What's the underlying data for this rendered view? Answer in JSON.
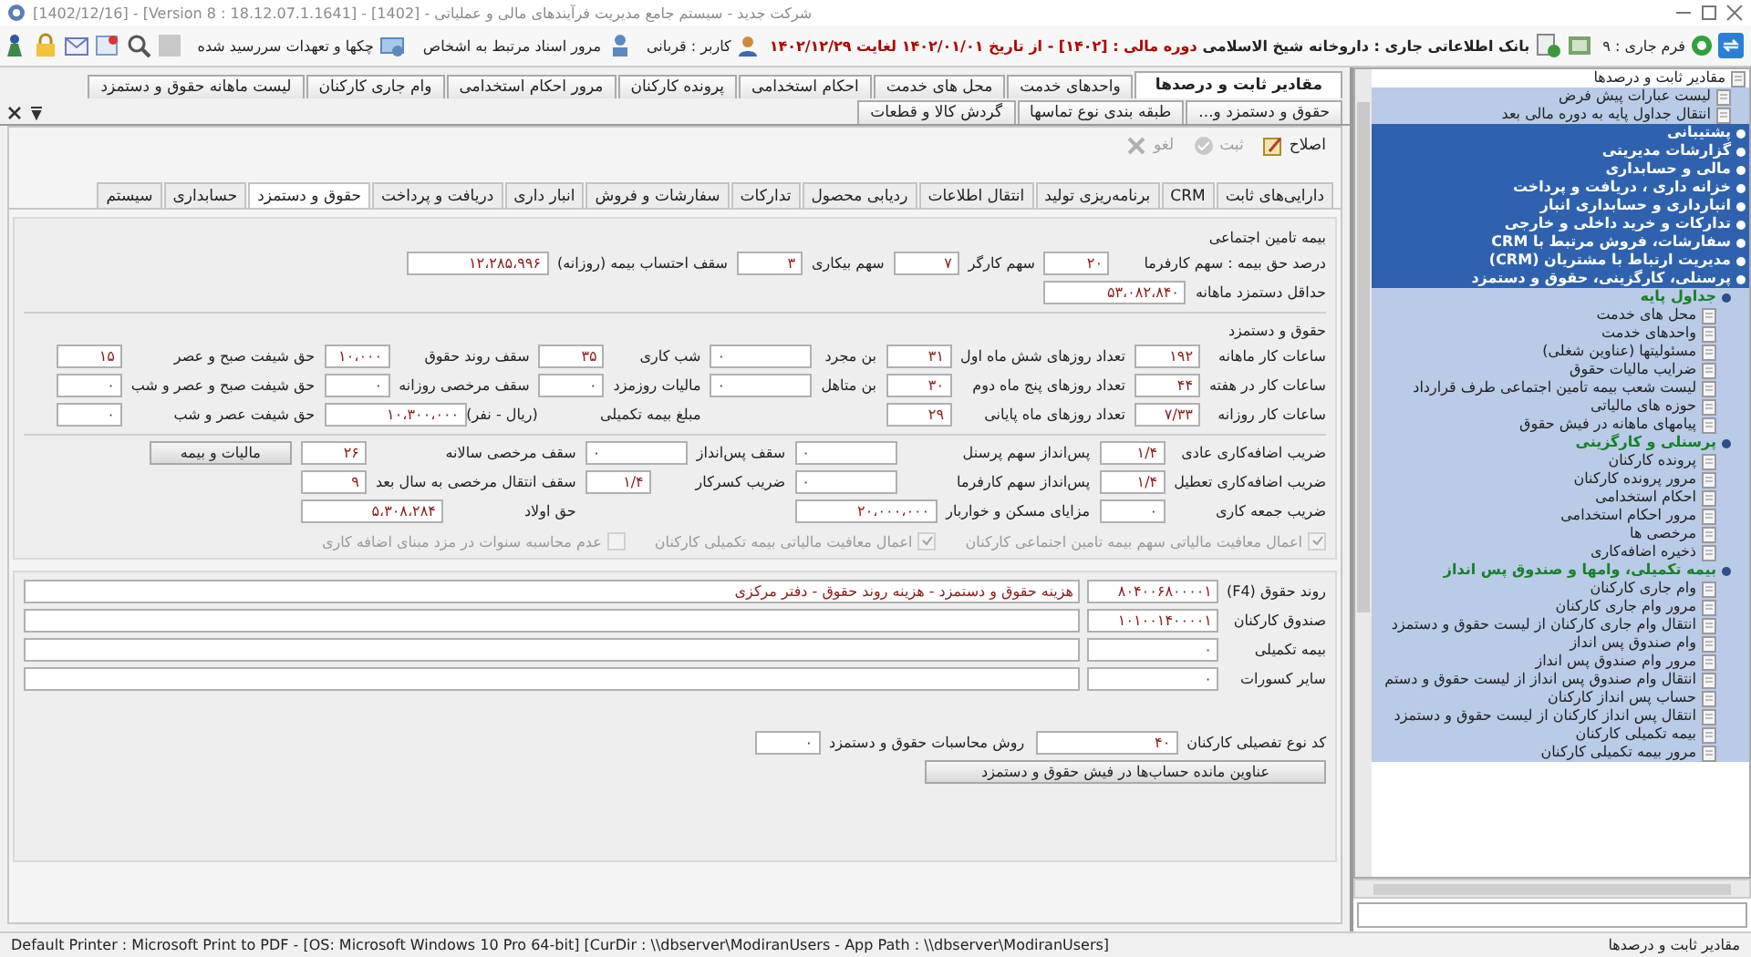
{
  "window": {
    "title": "شرکت جدید - سیستم جامع مدیریت فرآیندهای مالی و عملیاتی - [1402] - [Version 8 : 18.12.07.1.1641] - [1402/12/16]"
  },
  "toolbar": {
    "current_form": "فرم جاری : ۹",
    "database": "بانک اطلاعاتی جاری : داروخانه شیخ الاسلامی",
    "fiscal_period": "دوره مالی : [۱۴۰۲] - از تاریخ ۱۴۰۲/۰۱/۰۱ لغایت ۱۴۰۲/۱۲/۲۹",
    "user": "کاربر : قربانی",
    "links": [
      {
        "label": "مرور اسناد مرتبط به اشخاص"
      },
      {
        "label": "چکها و تعهدات سررسید شده"
      }
    ]
  },
  "document_tabs": [
    {
      "label": "مقادیر ثابت و درصدها",
      "selected": true
    },
    {
      "label": "واحدهای خدمت",
      "selected": false
    },
    {
      "label": "محل های خدمت",
      "selected": false
    },
    {
      "label": "احکام استخدامی",
      "selected": false
    },
    {
      "label": "پرونده کارکنان",
      "selected": false
    },
    {
      "label": "مرور احکام استخدامی",
      "selected": false
    },
    {
      "label": "وام جاری کارکنان",
      "selected": false
    },
    {
      "label": "لیست ماهانه حقوق و دستمزد",
      "selected": false
    },
    {
      "label": "حقوق و دستمزد و...",
      "selected": false
    },
    {
      "label": "طبقه بندی نوع تماسها",
      "selected": false
    },
    {
      "label": "گردش کالا و قطعات",
      "selected": false
    }
  ],
  "panel_toolbar": [
    {
      "label": "اصلاح",
      "disabled": false
    },
    {
      "label": "ثبت",
      "disabled": true
    },
    {
      "label": "لغو",
      "disabled": true
    }
  ],
  "module_tabs": [
    {
      "label": "دارایی‌های ثابت",
      "selected": false
    },
    {
      "label": "CRM",
      "selected": false
    },
    {
      "label": "برنامه‌ریزی تولید",
      "selected": false
    },
    {
      "label": "انتقال اطلاعات",
      "selected": false
    },
    {
      "label": "ردیابی محصول",
      "selected": false
    },
    {
      "label": "تدارکات",
      "selected": false
    },
    {
      "label": "سفارشات و فروش",
      "selected": false
    },
    {
      "label": "انبار داری",
      "selected": false
    },
    {
      "label": "دریافت و پرداخت",
      "selected": false
    },
    {
      "label": "حقوق و دستمزد",
      "selected": true
    },
    {
      "label": "حسابداری",
      "selected": false
    },
    {
      "label": "سیستم",
      "selected": false
    }
  ],
  "form": {
    "sections": [
      {
        "title": "بیمه تامین اجتماعی",
        "rows": [
          [
            {
              "kind": "number",
              "label": "درصد حق بیمه :  سهم کارفرما",
              "value": "۲۰"
            },
            {
              "kind": "number",
              "label": "سهم کارگر",
              "value": "۷"
            },
            {
              "kind": "number",
              "label": "سهم بیکاری",
              "value": "۳"
            },
            {
              "kind": "amount",
              "label": "سقف احتساب بیمه (روزانه)",
              "value": "۱۲،۲۸۵،۹۹۶"
            }
          ],
          [
            {
              "kind": "amount",
              "label": "حداقل دستمزد ماهانه",
              "value": "۵۳،۰۸۲،۸۴۰"
            }
          ]
        ]
      },
      {
        "title": "حقوق و دستمزد",
        "rows": [
          [
            {
              "kind": "number",
              "label": "ساعات کار ماهانه",
              "value": "۱۹۲"
            },
            {
              "kind": "number",
              "label": "تعداد روزهای شش ماه اول",
              "value": "۳۱"
            },
            {
              "kind": "select",
              "label": "بن مجرد",
              "value": "۰"
            },
            {
              "kind": "number",
              "label": "شب کاری",
              "value": "۳۵"
            },
            {
              "kind": "number",
              "label": "سقف روند حقوق",
              "value": "۱۰،۰۰۰"
            },
            {
              "kind": "number",
              "label": "حق شیفت صبح و عصر",
              "value": "۱۵"
            }
          ],
          [
            {
              "kind": "number",
              "label": "ساعات کار در هفته",
              "value": "۴۴"
            },
            {
              "kind": "number",
              "label": "تعداد روزهای پنج ماه دوم",
              "value": "۳۰"
            },
            {
              "kind": "select",
              "label": "بن متاهل",
              "value": "۰"
            },
            {
              "kind": "number",
              "label": "مالیات روزمزد",
              "value": "۰"
            },
            {
              "kind": "number",
              "label": "سقف مرخصی روزانه",
              "value": "۰"
            },
            {
              "kind": "number",
              "label": "حق شیفت صبح و عصر و شب",
              "value": "۰"
            }
          ],
          [
            {
              "kind": "number",
              "label": "ساعات کار روزانه",
              "value": "۷/۳۳"
            },
            {
              "kind": "number",
              "label": "تعداد روزهای ماه پایانی",
              "value": "۲۹"
            },
            null,
            {
              "kind": "amount",
              "label": "مبلغ بیمه تکمیلی",
              "value": "۱۰،۳۰۰،۰۰۰",
              "unit": "(ریال - نفر)"
            },
            null,
            {
              "kind": "number",
              "label": "حق شیفت عصر و شب",
              "value": "۰"
            }
          ]
        ]
      },
      {
        "rows": [
          [
            {
              "kind": "number",
              "label": "ضریب اضافه‌کاری عادی",
              "value": "۱/۴"
            },
            {
              "kind": "select",
              "label": "پس‌انداز سهم پرسنل",
              "value": "۰"
            },
            {
              "kind": "select",
              "label": "سقف پس‌انداز",
              "value": "۰"
            },
            {
              "kind": "number",
              "label": "سقف مرخصی سالانه",
              "value": "۲۶"
            },
            {
              "kind": "button",
              "label": "مالیات و بیمه"
            }
          ],
          [
            {
              "kind": "number",
              "label": "ضریب اضافه‌کاری تعطیل",
              "value": "۱/۴"
            },
            {
              "kind": "select",
              "label": "پس‌انداز سهم کارفرما",
              "value": "۰"
            },
            {
              "kind": "number",
              "label": "ضریب کسرکار",
              "value": "۱/۴"
            },
            {
              "kind": "number",
              "label": "سقف انتقال مرخصی به سال بعد",
              "value": "۹"
            }
          ],
          [
            {
              "kind": "number",
              "label": "ضریب جمعه کاری",
              "value": "۰"
            },
            {
              "kind": "amount",
              "label": "مزایای مسکن و خواربار",
              "value": "۲۰،۰۰۰،۰۰۰"
            },
            null,
            {
              "kind": "amount",
              "label": "حق اولاد",
              "value": "۵،۳۰۸،۲۸۴"
            }
          ]
        ]
      }
    ],
    "options": [
      {
        "label": "اعمال معافیت مالیاتی سهم بیمه تامین اجتماعی کارکنان",
        "checked": true,
        "disabled": true
      },
      {
        "label": "اعمال معافیت مالیاتی بیمه تکمیلی کارکنان",
        "checked": true,
        "disabled": true
      },
      {
        "label": "عدم محاسبه سنوات در مزد مبنای اضافه کاری",
        "checked": false,
        "disabled": true
      }
    ],
    "accounts": [
      {
        "label": "روند حقوق (F4)",
        "code": "۸۰۴۰۰۶۸۰۰۰۰۱",
        "description": "هزینه حقوق و دستمزد - هزینه روند حقوق - دفتر مرکزی"
      },
      {
        "label": "صندوق کارکنان",
        "code": "۱۰۱۰۰۱۴۰۰۰۰۱"
      },
      {
        "label": "بیمه تکمیلی",
        "code": "۰"
      },
      {
        "label": "سایر کسورات",
        "code": "۰"
      }
    ],
    "settings": [
      {
        "kind": "amount",
        "label": "کد نوع تفصیلی کارکنان",
        "value": "۴۰"
      },
      {
        "kind": "number",
        "label": "روش محاسبات حقوق و دستمزد",
        "value": "۰"
      }
    ],
    "buttons": [
      {
        "label": "عناوین مانده حساب‌ها در فیش حقوق و دستمزد"
      }
    ]
  },
  "side_tree": {
    "items": [
      {
        "kind": "form",
        "label": "مقادیر ثابت و درصدها",
        "children": [
          {
            "kind": "form",
            "label": "لیست عبارات پیش فرض"
          },
          {
            "kind": "form",
            "label": "انتقال جداول پایه به دوره مالی بعد"
          }
        ]
      },
      {
        "kind": "module",
        "label": "پشتیبانی"
      },
      {
        "kind": "module",
        "label": "گزارشات مدیریتی"
      },
      {
        "kind": "module",
        "label": "مالی و حسابداری"
      },
      {
        "kind": "module",
        "label": "خزانه داری ، دریافت و پرداخت"
      },
      {
        "kind": "module",
        "label": "انبارداری و حسابداری انبار"
      },
      {
        "kind": "module",
        "label": "تدارکات و خرید داخلی و خارجی"
      },
      {
        "kind": "module",
        "label": "سفارشات، فروش مرتبط با CRM"
      },
      {
        "kind": "module",
        "label": "مدیریت ارتباط با مشتریان (CRM)"
      },
      {
        "kind": "module",
        "label": "پرسنلی، کارگزینی، حقوق و دستمزد",
        "children": [
          {
            "kind": "group",
            "label": "جداول پایه",
            "children": [
              {
                "kind": "form",
                "label": "محل های خدمت"
              },
              {
                "kind": "form",
                "label": "واحدهای خدمت"
              },
              {
                "kind": "form",
                "label": "مسئولیتها (عناوین شغلی)"
              },
              {
                "kind": "form",
                "label": "ضرایب مالیات حقوق"
              },
              {
                "kind": "form",
                "label": "لیست شعب بیمه تامین اجتماعی طرف قرارداد"
              },
              {
                "kind": "form",
                "label": "حوزه های مالیاتی"
              },
              {
                "kind": "form",
                "label": "پیامهای ماهانه  در فیش حقوق"
              }
            ]
          },
          {
            "kind": "group",
            "label": "پرسنلی و کارگزینی",
            "children": [
              {
                "kind": "form",
                "label": "پرونده کارکنان"
              },
              {
                "kind": "form",
                "label": "مرور پرونده کارکنان"
              },
              {
                "kind": "form",
                "label": "احکام استخدامی"
              },
              {
                "kind": "form",
                "label": "مرور احکام استخدامی"
              },
              {
                "kind": "form",
                "label": "مرخصی ها"
              },
              {
                "kind": "form",
                "label": "ذخیره اضافه‌کاری"
              }
            ]
          },
          {
            "kind": "group",
            "label": "بیمه تکمیلی، وامها و صندوق پس انداز",
            "children": [
              {
                "kind": "form",
                "label": "وام جاری کارکنان"
              },
              {
                "kind": "form",
                "label": "مرور وام جاری کارکنان"
              },
              {
                "kind": "form",
                "label": "انتقال وام جاری کارکنان از لیست حقوق و دستمزد"
              },
              {
                "kind": "form",
                "label": "وام صندوق پس انداز"
              },
              {
                "kind": "form",
                "label": "مرور وام صندوق پس انداز"
              },
              {
                "kind": "form",
                "label": "انتقال وام صندوق پس انداز از لیست حقوق و دستم"
              },
              {
                "kind": "form",
                "label": "حساب پس انداز کارکنان"
              },
              {
                "kind": "form",
                "label": "انتقال پس انداز کارکنان از لیست حقوق و دستمزد"
              },
              {
                "kind": "form",
                "label": "بیمه تکمیلی کارکنان"
              },
              {
                "kind": "form",
                "label": "مرور بیمه تکمیلی کارکنان"
              }
            ]
          }
        ]
      }
    ]
  },
  "status_bar": {
    "text": "Default Printer : Microsoft Print to PDF - [OS: Microsoft Windows 10 Pro 64-bit]  [CurDir : \\\\dbserver\\ModiranUsers - App Path : \\\\dbserver\\ModiranUsers]",
    "current_form": "مقادیر ثابت و درصدها"
  }
}
